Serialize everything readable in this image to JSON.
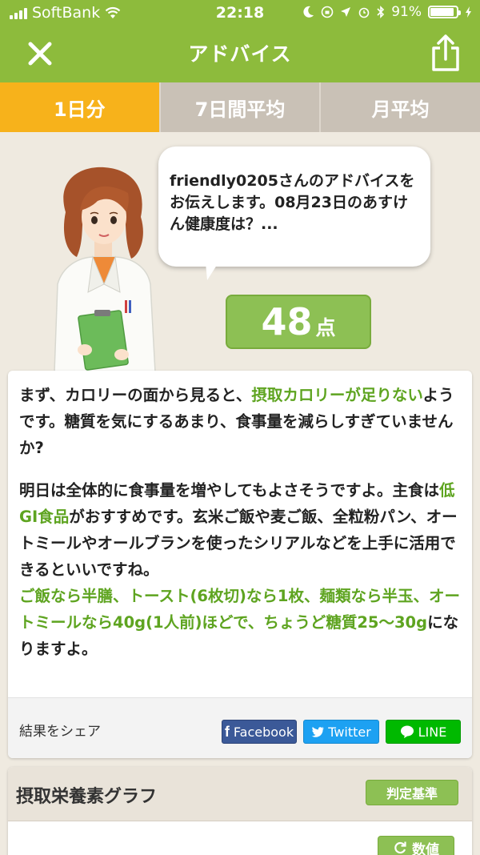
{
  "status": {
    "carrier": "SoftBank",
    "time": "22:18",
    "battery": "91%",
    "battery_level": 0.91
  },
  "nav": {
    "title": "アドバイス"
  },
  "tabs": [
    {
      "label": "1日分",
      "active": true
    },
    {
      "label": "7日間平均",
      "active": false
    },
    {
      "label": "月平均",
      "active": false
    }
  ],
  "bubble": {
    "text": "friendly0205さんのアドバイスをお伝えします。08月23日のあすけん健康度は？..."
  },
  "score": {
    "value": "48",
    "unit": "点"
  },
  "advice": {
    "p1_a": "まず、カロリーの面から見ると、",
    "p1_b": "摂取カロリーが足りない",
    "p1_c": "ようです。糖質を気にするあまり、食事量を減らしすぎていませんか?",
    "p2_a": "明日は全体的に食事量を増やしてもよさそうですよ。主食は",
    "p2_b": "低GI食品",
    "p2_c": "がおすすめです。玄米ご飯や麦ご飯、全粒粉パン、オートミールやオールブランを使ったシリアルなどを上手に活用できるといいですね。",
    "p2_d": "ご飯なら半膳、トースト(6枚切)なら1枚、麺類なら半玉、オートミールなら40g(1人前)ほどで、ちょうど糖質25〜30g",
    "p2_e": "になりますよ。"
  },
  "share": {
    "label": "結果をシェア",
    "facebook": "Facebook",
    "twitter": "Twitter",
    "line": "LINE"
  },
  "graph": {
    "title": "摂取栄養素グラフ",
    "criteria_label": "判定基準",
    "value_label": "数値"
  },
  "colors": {
    "nav_green": "#8dbb3c",
    "tab_active": "#f7b21b",
    "highlight_green": "#5ea420",
    "facebook": "#3b5998",
    "twitter": "#1da1f2",
    "line": "#00b900"
  }
}
